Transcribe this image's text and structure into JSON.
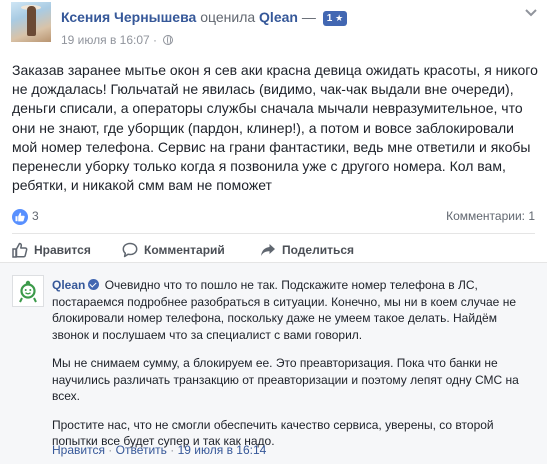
{
  "post": {
    "author_name": "Ксения Чернышева",
    "rated_text": "оценила",
    "page_name": "Qlean",
    "dash": "—",
    "rating_badge": "1",
    "rating_star": "★",
    "date": "19 июля в 16:07",
    "separator": "·",
    "review_text": "Заказав заранее мытье окон я сев аки красна девица ожидать красоты, я никого не дождалась! Гюльчатай не явилась (видимо, чак-чак выдали вне очереди), деньги списали, а операторы службы сначала мычали невразумительное, что они не знают, где уборщик (пардон, клинер!), а потом и вовсе заблокировали мой номер телефона. Сервис на грани фантастики, ведь мне ответили и якобы перенесли уборку только когда я позвонила уже с другого номера. Кол вам, ребятки, и никакой смм вам не поможет",
    "likes_count": "3",
    "comments_count": "Комментарии: 1"
  },
  "actions": {
    "like": "Нравится",
    "comment": "Комментарий",
    "share": "Поделиться"
  },
  "comment": {
    "author": "Qlean",
    "paragraph1": "Очевидно что то пошло не так. Подскажите номер телефона в ЛС, постараемся подробнее разобраться в ситуации. Конечно, мы ни в коем случае не блокировали номер телефона, поскольку даже не умеем такое делать. Найдём звонок и послушаем что за специалист с вами говорил.",
    "paragraph2": "Мы не снимаем сумму, а блокируем ее. Это преавторизация. Пока что банки не научились различать транзакцию от преавторизации и поэтому лепят одну СМС на всех.",
    "paragraph3": "Простите нас, что не смогли обеспечить качество сервиса, уверены, со второй попытки все будет супер и так как надо.",
    "like": "Нравится",
    "reply": "Ответить",
    "separator": "·",
    "date": "19 июля в 16:14"
  },
  "icons": {
    "chevron": "chevron-down-icon",
    "globe": "globe-icon",
    "like_reaction": "thumbs-up-icon",
    "comment": "comment-icon",
    "share": "share-icon",
    "verified": "verified-badge-icon",
    "qlean_logo": "qlean-logo-icon"
  },
  "colors": {
    "link": "#365899",
    "badge": "#4267b2",
    "like_bubble": "#5890ff",
    "meta": "#90949c",
    "comment_bg": "#f6f7f9",
    "qlean_green": "#3c9a4a"
  }
}
